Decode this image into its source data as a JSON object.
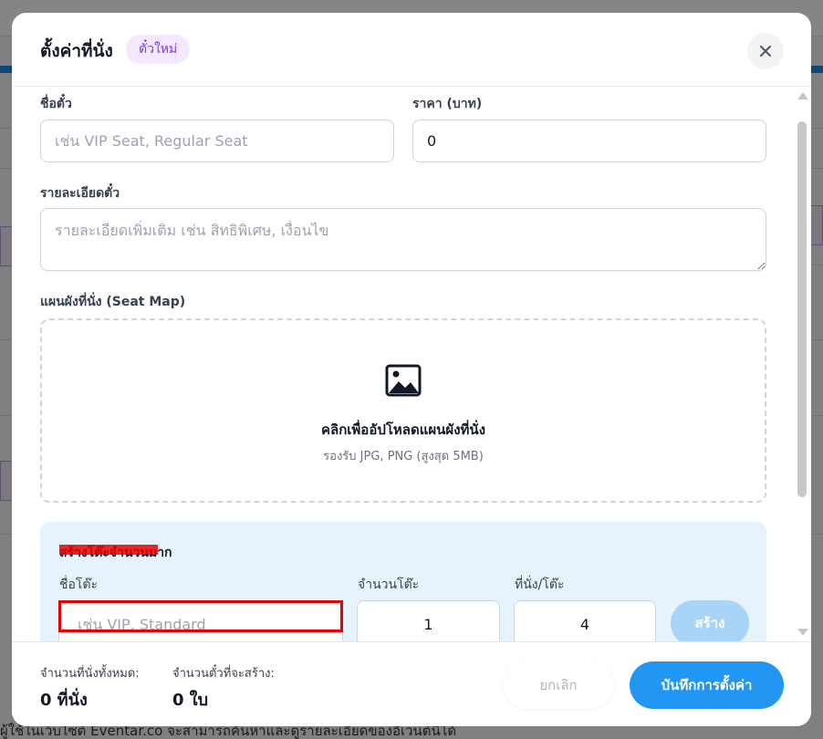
{
  "background": {
    "footer_text": "ผู้ใช้ในเว็บไซต์ Eventar.co จะสามารถค้นหาและดูรายละเอียดของอีเวนต์นี้ได้"
  },
  "modal": {
    "title": "ตั้งค่าที่นั่ง",
    "badge": "ตั๋วใหม่",
    "close_icon": "close-icon"
  },
  "form": {
    "ticket_name": {
      "label": "ชื่อตั๋ว",
      "placeholder": "เช่น VIP Seat, Regular Seat",
      "value": ""
    },
    "price": {
      "label": "ราคา (บาท)",
      "value": "0"
    },
    "description": {
      "label": "รายละเอียดตั๋ว",
      "placeholder": "รายละเอียดเพิ่มเติม เช่น สิทธิพิเศษ, เงื่อนไข",
      "value": ""
    },
    "seat_map": {
      "label": "แผนผังที่นั่ง (Seat Map)",
      "icon": "image-icon",
      "title": "คลิกเพื่ออัปโหลดแผนผังที่นั่ง",
      "hint": "รองรับ JPG, PNG (สูงสุด 5MB)"
    }
  },
  "bulk_create": {
    "title": "สร้างโต๊ะจำนวนมาก",
    "table_name": {
      "label": "ชื่อโต๊ะ",
      "placeholder": "เช่น VIP, Standard",
      "value": ""
    },
    "table_count": {
      "label": "จำนวนโต๊ะ",
      "value": "1"
    },
    "seats_per_table": {
      "label": "ที่นั่ง/โต๊ะ",
      "value": "4"
    },
    "create_label": "สร้าง"
  },
  "footer": {
    "total_seats_label": "จำนวนที่นั่งทั้งหมด:",
    "total_seats_value": "0 ที่นั่ง",
    "tickets_to_create_label": "จำนวนตั๋วที่จะสร้าง:",
    "tickets_to_create_value": "0 ใบ",
    "cancel_label": "ยกเลิก",
    "save_label": "บันทึกการตั้งค่า"
  },
  "colors": {
    "primary": "#2196f3",
    "badge_bg": "#f3e8ff",
    "badge_text": "#7c3aed",
    "panel_bg": "#e6f2fc",
    "annotation": "#e60000"
  }
}
